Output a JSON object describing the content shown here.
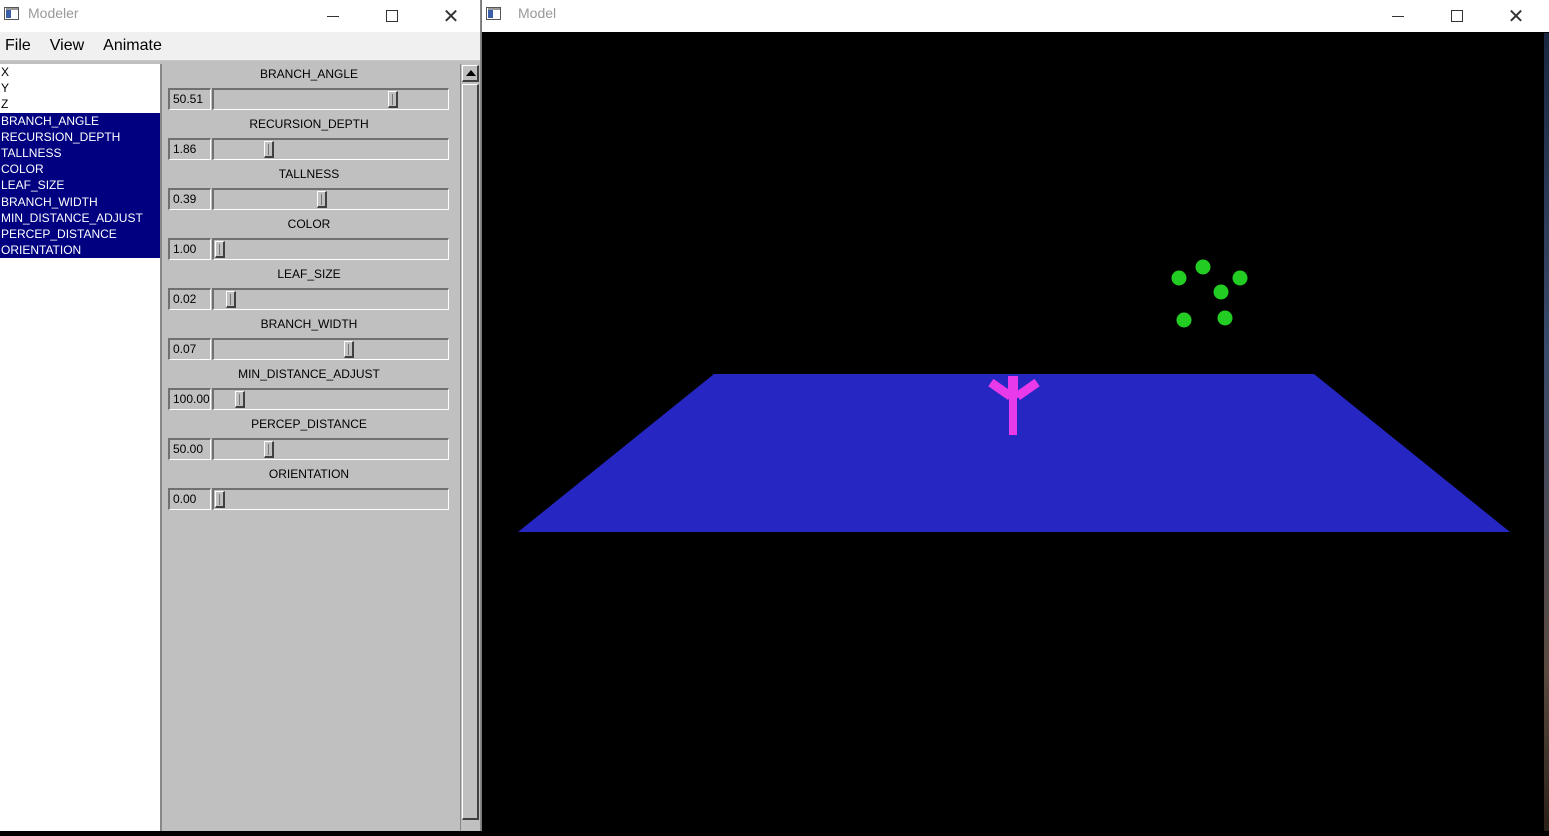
{
  "modeler_window": {
    "title": "Modeler",
    "menu": [
      "File",
      "View",
      "Animate"
    ],
    "list": [
      {
        "label": "X",
        "selected": false
      },
      {
        "label": "Y",
        "selected": false
      },
      {
        "label": "Z",
        "selected": false
      },
      {
        "label": "BRANCH_ANGLE",
        "selected": true
      },
      {
        "label": "RECURSION_DEPTH",
        "selected": true
      },
      {
        "label": "TALLNESS",
        "selected": true
      },
      {
        "label": "COLOR",
        "selected": true
      },
      {
        "label": "LEAF_SIZE",
        "selected": true
      },
      {
        "label": "BRANCH_WIDTH",
        "selected": true
      },
      {
        "label": "MIN_DISTANCE_ADJUST",
        "selected": true
      },
      {
        "label": "PERCEP_DISTANCE",
        "selected": true
      },
      {
        "label": "ORIENTATION",
        "selected": true
      }
    ],
    "sliders": [
      {
        "name": "BRANCH_ANGLE",
        "value": "50.51",
        "position": 0.78
      },
      {
        "name": "RECURSION_DEPTH",
        "value": "1.86",
        "position": 0.22
      },
      {
        "name": "TALLNESS",
        "value": "0.39",
        "position": 0.46
      },
      {
        "name": "COLOR",
        "value": "1.00",
        "position": 0.0
      },
      {
        "name": "LEAF_SIZE",
        "value": "0.02",
        "position": 0.05
      },
      {
        "name": "BRANCH_WIDTH",
        "value": "0.07",
        "position": 0.58
      },
      {
        "name": "MIN_DISTANCE_ADJUST",
        "value": "100.00",
        "position": 0.09
      },
      {
        "name": "PERCEP_DISTANCE",
        "value": "50.00",
        "position": 0.22
      },
      {
        "name": "ORIENTATION",
        "value": "0.00",
        "position": 0.0
      }
    ]
  },
  "model_window": {
    "title": "Model"
  },
  "colors": {
    "list_selection": "#000080",
    "ground_plane": "#2626c2",
    "tree": "#e83ae8",
    "leaves": "#22cc22",
    "background": "#000000"
  },
  "icons": [
    "app-icon",
    "minimize-icon",
    "maximize-icon",
    "close-icon",
    "scroll-up-icon"
  ]
}
